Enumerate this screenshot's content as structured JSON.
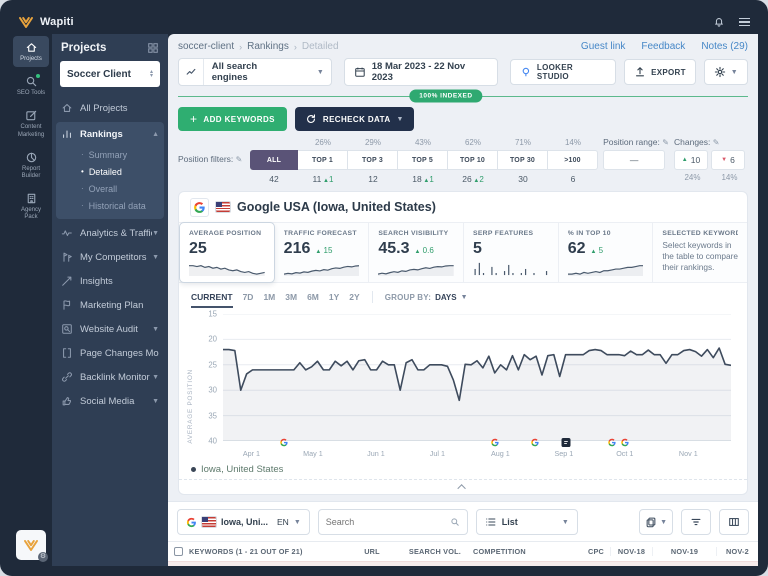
{
  "topbar": {
    "brand": "Wapiti"
  },
  "rail": {
    "items": [
      {
        "label": "Projects",
        "icon": "home-icon",
        "active": true
      },
      {
        "label": "SEO Tools",
        "icon": "search-icon",
        "badge": true
      },
      {
        "label": "Content Marketing",
        "icon": "content-icon"
      },
      {
        "label": "Report Builder",
        "icon": "report-icon"
      },
      {
        "label": "Agency Pack",
        "icon": "agency-icon"
      }
    ]
  },
  "sidebar": {
    "title": "Projects",
    "project": "Soccer Client",
    "items": [
      {
        "label": "All Projects",
        "icon": "home-icon"
      },
      {
        "label": "Rankings",
        "icon": "rankings-icon",
        "expanded": true,
        "active": true,
        "children": [
          {
            "label": "Summary"
          },
          {
            "label": "Detailed",
            "active": true
          },
          {
            "label": "Overall"
          },
          {
            "label": "Historical data"
          }
        ]
      },
      {
        "label": "Analytics & Traffic",
        "icon": "analytics-icon",
        "chevron": true
      },
      {
        "label": "My Competitors",
        "icon": "competitors-icon",
        "chevron": true
      },
      {
        "label": "Insights",
        "icon": "insights-icon"
      },
      {
        "label": "Marketing Plan",
        "icon": "marketing-icon"
      },
      {
        "label": "Website Audit",
        "icon": "audit-icon",
        "chevron": true
      },
      {
        "label": "Page Changes Monitor",
        "icon": "page-changes-icon"
      },
      {
        "label": "Backlink Monitor",
        "icon": "backlink-icon",
        "chevron": true
      },
      {
        "label": "Social Media",
        "icon": "social-icon",
        "chevron": true
      }
    ]
  },
  "header": {
    "breadcrumb": [
      "soccer-client",
      "Rankings",
      "Detailed"
    ],
    "links": [
      "Guest link",
      "Feedback",
      "Notes (29)"
    ]
  },
  "controls": {
    "engine": "All search engines",
    "date": "18 Mar 2023 - 22 Nov 2023",
    "looker": "LOOKER STUDIO",
    "export": "EXPORT",
    "indexed": "100% INDEXED"
  },
  "actions": {
    "add": "ADD KEYWORDS",
    "recheck": "RECHECK DATA"
  },
  "filters": {
    "label": "Position filters:",
    "segments": [
      {
        "name": "ALL",
        "count": "42",
        "selected": true
      },
      {
        "name": "TOP 1",
        "pct": "26%",
        "count": "11",
        "delta": "1",
        "dir": "up"
      },
      {
        "name": "TOP 3",
        "pct": "29%",
        "count": "12"
      },
      {
        "name": "TOP 5",
        "pct": "43%",
        "count": "18",
        "delta": "1",
        "dir": "up"
      },
      {
        "name": "TOP 10",
        "pct": "62%",
        "count": "26",
        "delta": "2",
        "dir": "up"
      },
      {
        "name": "TOP 30",
        "pct": "71%",
        "count": "30"
      },
      {
        "name": ">100",
        "pct": "14%",
        "count": "6"
      }
    ],
    "position_range": {
      "label": "Position range:",
      "value": "—"
    },
    "changes": {
      "label": "Changes:",
      "up": {
        "value": "10",
        "pct": "24%"
      },
      "down": {
        "value": "6",
        "pct": "14%"
      }
    }
  },
  "engine_header": {
    "title": "Google USA (Iowa, United States)"
  },
  "metrics": [
    {
      "label": "AVERAGE POSITION",
      "value": "25",
      "spark": "average_position",
      "selected": true
    },
    {
      "label": "TRAFFIC FORECAST",
      "value": "216",
      "delta": "15",
      "spark": "traffic_forecast"
    },
    {
      "label": "SEARCH VISIBILITY",
      "value": "45.3",
      "delta": "0.6",
      "spark": "search_visibility"
    },
    {
      "label": "SERP FEATURES",
      "value": "5",
      "spark": "serp_features",
      "spark_type": "bars"
    },
    {
      "label": "% IN TOP 10",
      "value": "62",
      "delta": "5",
      "spark": "in_top10"
    },
    {
      "label": "SELECTED KEYWORDS",
      "text": "Select keywords in the table to compare their rankings."
    }
  ],
  "chart_controls": {
    "tabs": [
      "CURRENT",
      "7D",
      "1M",
      "3M",
      "6M",
      "1Y",
      "2Y"
    ],
    "active_tab": "CURRENT",
    "group_by_label": "GROUP BY:",
    "group_by_value": "DAYS"
  },
  "chart_data": {
    "type": "line",
    "ylabel": "AVERAGE POSITION",
    "y_inverted": true,
    "ylim": [
      15,
      40
    ],
    "yticks": [
      15,
      20,
      25,
      30,
      35,
      40
    ],
    "xticks": [
      {
        "label": "Apr 1",
        "f": 0.056
      },
      {
        "label": "May 1",
        "f": 0.177
      },
      {
        "label": "Jun 1",
        "f": 0.301
      },
      {
        "label": "Jul 1",
        "f": 0.422
      },
      {
        "label": "Aug 1",
        "f": 0.546
      },
      {
        "label": "Sep 1",
        "f": 0.671
      },
      {
        "label": "Oct 1",
        "f": 0.791
      },
      {
        "label": "Nov 1",
        "f": 0.916
      }
    ],
    "series": [
      {
        "name": "Iowa, United States",
        "values": [
          22,
          22,
          22.2,
          30,
          26.8,
          26,
          26,
          26,
          26,
          26,
          26,
          26,
          26,
          24.6,
          26,
          25.4,
          24.3,
          26,
          26,
          24.3,
          25.2,
          24.3,
          26,
          24.2,
          24,
          26,
          26,
          24.3,
          25,
          25,
          30,
          24.6,
          24,
          26,
          26,
          25,
          25,
          25,
          25.3,
          28,
          32,
          24.9,
          25,
          24.2,
          25.6,
          23.3,
          26.6,
          25,
          26,
          23.2,
          26,
          23,
          24,
          23.3,
          27,
          23.2,
          23,
          27.3,
          23,
          23,
          23,
          23,
          22.2,
          22,
          22.2,
          23,
          23,
          23,
          23.2,
          22.3,
          23,
          23,
          22.1,
          23,
          23,
          24.7,
          23,
          23,
          22.2,
          22,
          22.4,
          23.3,
          22,
          23.6,
          21.7,
          24.9,
          25.1
        ]
      }
    ],
    "markers": [
      {
        "f": 0.12,
        "type": "google"
      },
      {
        "f": 0.535,
        "type": "google"
      },
      {
        "f": 0.615,
        "type": "google"
      },
      {
        "f": 0.675,
        "type": "note"
      },
      {
        "f": 0.765,
        "type": "google"
      },
      {
        "f": 0.792,
        "type": "google"
      }
    ],
    "sparklines": {
      "average_position": [
        25.8,
        25.8,
        25.7,
        25.8,
        25.6,
        25.7,
        25.5,
        25.6,
        25.4,
        25.5,
        25.3,
        25.2,
        25.3,
        25.1,
        25.0,
        25.1,
        24.9,
        24.8,
        24.9,
        25.0
      ],
      "traffic_forecast": [
        182,
        185,
        183,
        188,
        186,
        191,
        189,
        194,
        197,
        195,
        200,
        198,
        204,
        207,
        205,
        210,
        213,
        211,
        215,
        216
      ],
      "search_visibility": [
        42.5,
        42.8,
        42.6,
        43.0,
        43.3,
        43.1,
        43.6,
        43.4,
        43.9,
        44.1,
        43.9,
        44.3,
        44.6,
        44.4,
        44.8,
        45.0,
        44.9,
        45.2,
        45.3,
        45.3
      ],
      "serp_features": [
        3,
        6,
        1,
        0,
        4,
        1,
        0,
        2,
        5,
        1,
        0,
        1,
        3,
        0,
        1,
        0,
        0,
        2
      ],
      "in_top10": [
        57,
        57,
        57.5,
        57,
        58,
        57.5,
        58,
        58.5,
        58,
        59,
        59,
        59.5,
        60,
        60,
        60.5,
        61,
        61,
        61.5,
        62,
        62
      ]
    }
  },
  "legend": {
    "text": "Iowa, United States"
  },
  "toolbar": {
    "location": "Iowa, Uni...",
    "lang": "EN",
    "search_placeholder": "Search",
    "view": "List"
  },
  "table": {
    "columns": [
      "KEYWORDS (1 - 21 OUT OF 21)",
      "URL",
      "SEARCH VOL.",
      "COMPETITION",
      "CPC",
      "NOV-18",
      "NOV-19",
      "NOV-2"
    ]
  },
  "colors": {
    "frame": "#1f2a3a",
    "sidebar": "#2f3e54",
    "accent_green": "#2fae71",
    "selected_purple": "#5a5377",
    "link_blue": "#4687c7",
    "up_green": "#2f9d6b",
    "down_red": "#d9596a",
    "line": "#3e4b5d"
  }
}
